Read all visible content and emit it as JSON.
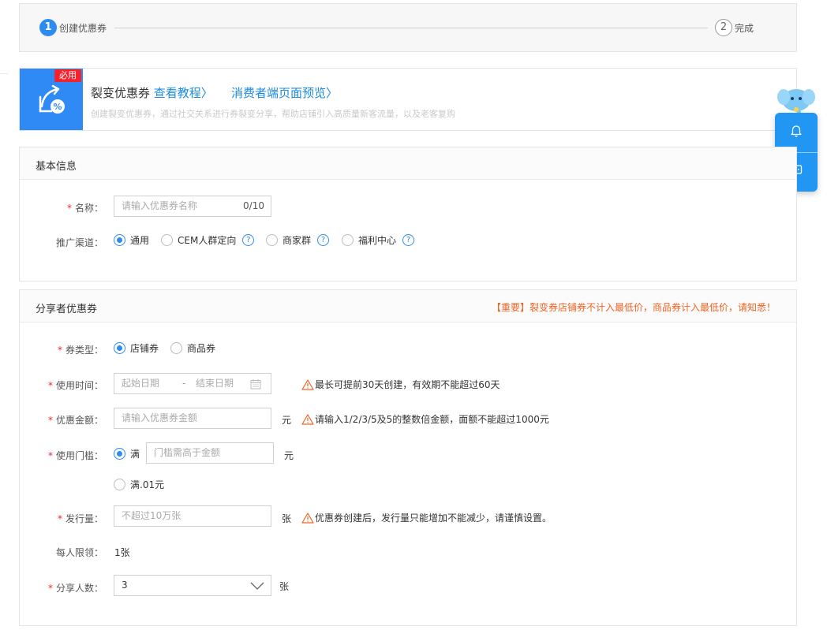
{
  "steps": {
    "step1": {
      "num": "1",
      "label": "创建优惠券"
    },
    "step2": {
      "num": "2",
      "label": "完成"
    }
  },
  "banner": {
    "tag": "必用",
    "title": "裂变优惠券",
    "link_tutorial": "查看教程〉",
    "link_preview": "消费者端页面预览〉",
    "desc": "创建裂变优惠券，通过社交关系进行券裂变分享，帮助店铺引入高质量新客流量，以及老客复购"
  },
  "basic": {
    "title": "基本信息",
    "name_label": "名称：",
    "name_placeholder": "请输入优惠券名称",
    "name_counter": "0/10",
    "channel_label": "推广渠道：",
    "channels": [
      {
        "label": "通用",
        "checked": true
      },
      {
        "label": "CEM人群定向",
        "checked": false
      },
      {
        "label": "商家群",
        "checked": false
      },
      {
        "label": "福利中心",
        "checked": false
      }
    ]
  },
  "sharer": {
    "title": "分享者优惠券",
    "note": "【重要】裂变券店铺券不计入最低价，商品券计入最低价，请知悉！",
    "type_label": "券类型：",
    "types": [
      {
        "label": "店铺券",
        "checked": true
      },
      {
        "label": "商品券",
        "checked": false
      }
    ],
    "time_label": "使用时间：",
    "start_placeholder": "起始日期",
    "date_sep": "-",
    "end_placeholder": "结束日期",
    "time_warn": "最长可提前30天创建，有效期不能超过60天",
    "amount_label": "优惠金额：",
    "amount_placeholder": "请输入优惠券金额",
    "amount_unit": "元",
    "amount_warn": "请输入1/2/3/5及5的整数倍金额，面额不能超过1000元",
    "threshold_label": "使用门槛：",
    "threshold_full": "满",
    "threshold_placeholder": "门槛需高于金额",
    "threshold_unit": "元",
    "threshold_alt": "满.01元",
    "issue_label": "发行量：",
    "issue_placeholder": "不超过10万张",
    "issue_unit": "张",
    "issue_warn": "优惠券创建后，发行量只能增加不能减少，请谨慎设置。",
    "limit_label": "每人限领：",
    "limit_value": "1张",
    "share_label": "分享人数：",
    "share_value": "3",
    "share_unit": "张"
  }
}
